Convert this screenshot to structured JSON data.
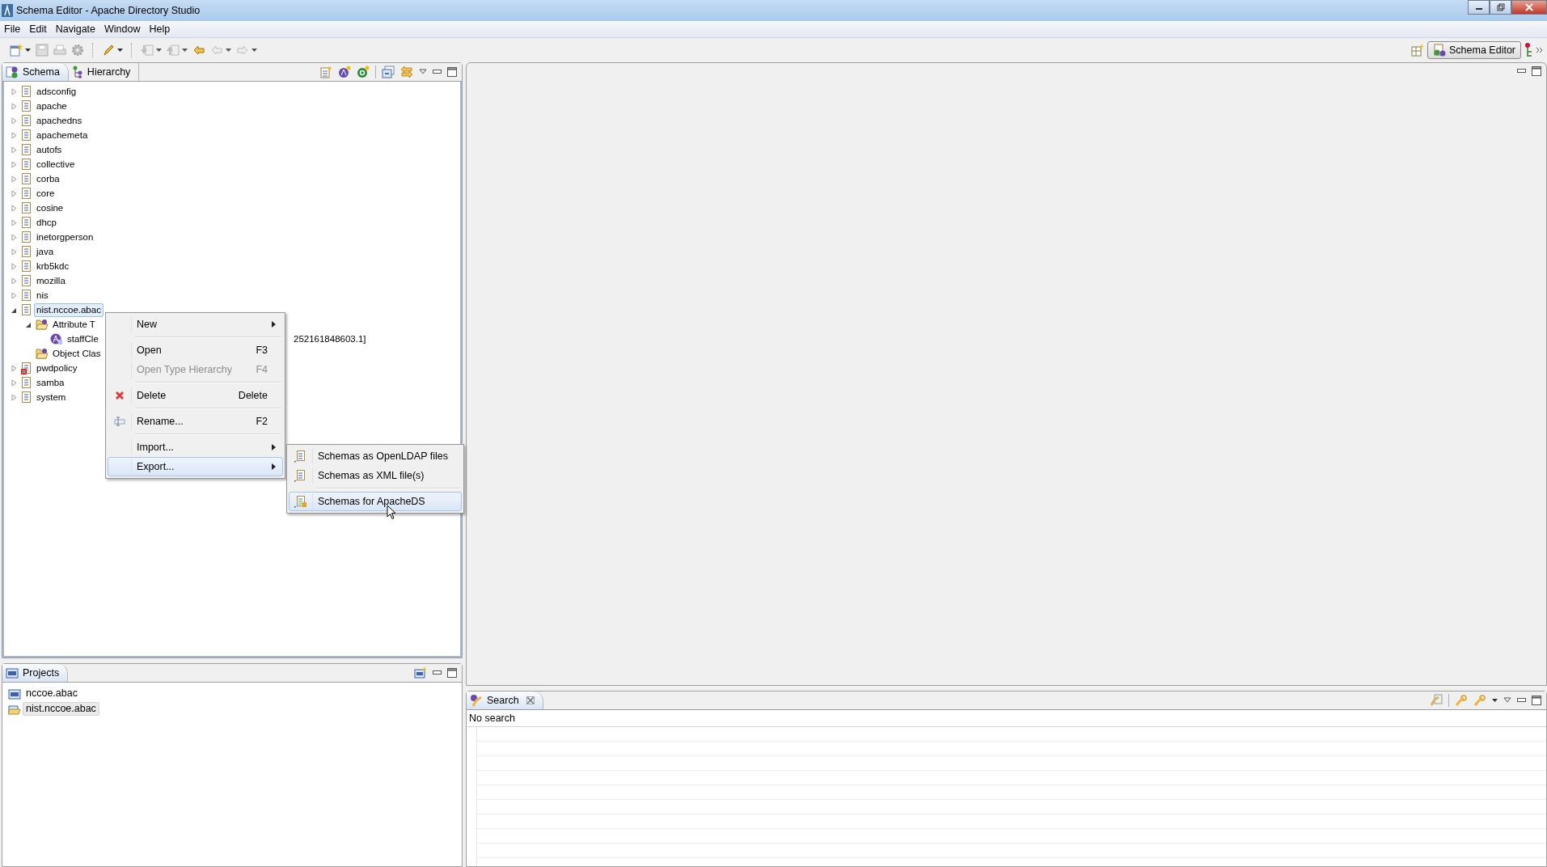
{
  "window": {
    "title": "Schema Editor - Apache Directory Studio"
  },
  "menu": [
    "File",
    "Edit",
    "Navigate",
    "Window",
    "Help"
  ],
  "perspective": {
    "label": "Schema Editor",
    "selected": true
  },
  "schema_panel": {
    "tabs": [
      {
        "label": "Schema",
        "selected": true
      },
      {
        "label": "Hierarchy",
        "selected": false
      }
    ],
    "tree": [
      {
        "label": "adsconfig",
        "kind": "schema",
        "expanded": false,
        "selected": false
      },
      {
        "label": "apache",
        "kind": "schema",
        "expanded": false,
        "selected": false
      },
      {
        "label": "apachedns",
        "kind": "schema",
        "expanded": false,
        "selected": false
      },
      {
        "label": "apachemeta",
        "kind": "schema",
        "expanded": false,
        "selected": false
      },
      {
        "label": "autofs",
        "kind": "schema",
        "expanded": false,
        "selected": false
      },
      {
        "label": "collective",
        "kind": "schema",
        "expanded": false,
        "selected": false
      },
      {
        "label": "corba",
        "kind": "schema",
        "expanded": false,
        "selected": false
      },
      {
        "label": "core",
        "kind": "schema",
        "expanded": false,
        "selected": false
      },
      {
        "label": "cosine",
        "kind": "schema",
        "expanded": false,
        "selected": false
      },
      {
        "label": "dhcp",
        "kind": "schema",
        "expanded": false,
        "selected": false
      },
      {
        "label": "inetorgperson",
        "kind": "schema",
        "expanded": false,
        "selected": false
      },
      {
        "label": "java",
        "kind": "schema",
        "expanded": false,
        "selected": false
      },
      {
        "label": "krb5kdc",
        "kind": "schema",
        "expanded": false,
        "selected": false
      },
      {
        "label": "mozilla",
        "kind": "schema",
        "expanded": false,
        "selected": false
      },
      {
        "label": "nis",
        "kind": "schema",
        "expanded": false,
        "selected": false
      },
      {
        "label": "nist.nccoe.abac",
        "kind": "schema",
        "expanded": true,
        "selected": true,
        "children": [
          {
            "label": "Attribute T",
            "kind": "folder",
            "expanded": true,
            "selected": false,
            "children": [
              {
                "label": "staffCle",
                "tail": "252161848603.1]",
                "kind": "attribute",
                "selected": false
              }
            ]
          },
          {
            "label": "Object Clas",
            "kind": "folder",
            "selected": false
          }
        ]
      },
      {
        "label": "pwdpolicy",
        "kind": "schema-error",
        "expanded": false,
        "selected": false
      },
      {
        "label": "samba",
        "kind": "schema",
        "expanded": false,
        "selected": false
      },
      {
        "label": "system",
        "kind": "schema",
        "expanded": false,
        "selected": false
      }
    ]
  },
  "context_menu": {
    "items": [
      {
        "kind": "submenu",
        "label": "New",
        "selected": false,
        "disabled": false
      },
      {
        "kind": "separator"
      },
      {
        "kind": "command",
        "label": "Open",
        "shortcut": "F3",
        "selected": false,
        "disabled": false
      },
      {
        "kind": "command",
        "label": "Open Type Hierarchy",
        "shortcut": "F4",
        "selected": false,
        "disabled": true
      },
      {
        "kind": "separator"
      },
      {
        "kind": "delete",
        "label": "Delete",
        "shortcut": "Delete",
        "selected": false,
        "disabled": false
      },
      {
        "kind": "separator"
      },
      {
        "kind": "rename",
        "label": "Rename...",
        "shortcut": "F2",
        "selected": false,
        "disabled": false
      },
      {
        "kind": "separator"
      },
      {
        "kind": "submenu",
        "label": "Import...",
        "selected": false,
        "disabled": false
      },
      {
        "kind": "submenu",
        "label": "Export...",
        "selected": true,
        "disabled": false
      }
    ]
  },
  "export_submenu": {
    "items": [
      {
        "kind": "item",
        "label": "Schemas as OpenLDAP files",
        "selected": false
      },
      {
        "kind": "item",
        "label": "Schemas as XML file(s)",
        "selected": false
      },
      {
        "kind": "separator"
      },
      {
        "kind": "server",
        "label": "Schemas for ApacheDS",
        "selected": true
      }
    ]
  },
  "projects_panel": {
    "title": "Projects",
    "items": [
      {
        "label": "nccoe.abac",
        "open": false,
        "selected": false
      },
      {
        "label": "nist.nccoe.abac",
        "open": true,
        "selected": true
      }
    ]
  },
  "search_panel": {
    "title": "Search",
    "status": "No search"
  }
}
